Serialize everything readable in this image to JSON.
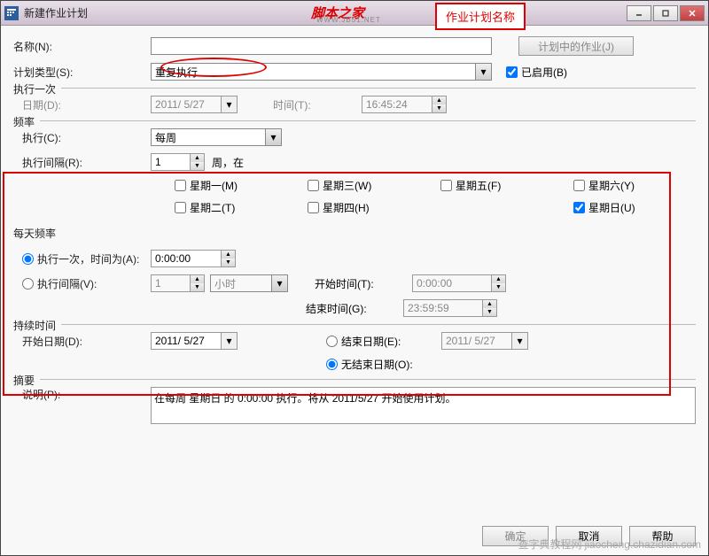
{
  "window": {
    "title": "新建作业计划"
  },
  "watermark": "脚本之家",
  "watermark_url": "WWW.JB51.NET",
  "annotation": "作业计划名称",
  "bottom_watermark": "jiaocheng.chazidian.com",
  "bottom_watermark2": "查字典教程网",
  "labels": {
    "name": "名称(N):",
    "type": "计划类型(S):",
    "jobs_btn": "计划中的作业(J)",
    "enabled": "已启用(B)",
    "once": "执行一次",
    "date": "日期(D):",
    "time": "时间(T):",
    "freq": "频率",
    "exec": "执行(C):",
    "interval": "执行间隔(R):",
    "week_unit": "周，在",
    "daily": "每天频率",
    "once_at": "执行一次，时间为(A):",
    "interval_at": "执行间隔(V):",
    "hour": "小时",
    "start_time": "开始时间(T):",
    "end_time": "结束时间(G):",
    "duration": "持续时间",
    "start_date": "开始日期(D):",
    "end_date": "结束日期(E):",
    "no_end": "无结束日期(O):",
    "summary": "摘要",
    "desc": "说明(P):",
    "ok": "确定",
    "cancel": "取消",
    "help": "帮助"
  },
  "values": {
    "name": "",
    "type": "重复执行",
    "date": "2011/ 5/27",
    "time": "16:45:24",
    "exec": "每周",
    "interval": "1",
    "once_time": "0:00:00",
    "int_val": "1",
    "int_unit": "小时",
    "start_time": "0:00:00",
    "end_time": "23:59:59",
    "start_date": "2011/ 5/27",
    "end_date": "2011/ 5/27",
    "desc": "在每周 星期日 的 0:00:00 执行。将从 2011/5/27 开始使用计划。"
  },
  "weekdays": {
    "mon": "星期一(M)",
    "tue": "星期二(T)",
    "wed": "星期三(W)",
    "thu": "星期四(H)",
    "fri": "星期五(F)",
    "sat": "星期六(Y)",
    "sun": "星期日(U)"
  }
}
